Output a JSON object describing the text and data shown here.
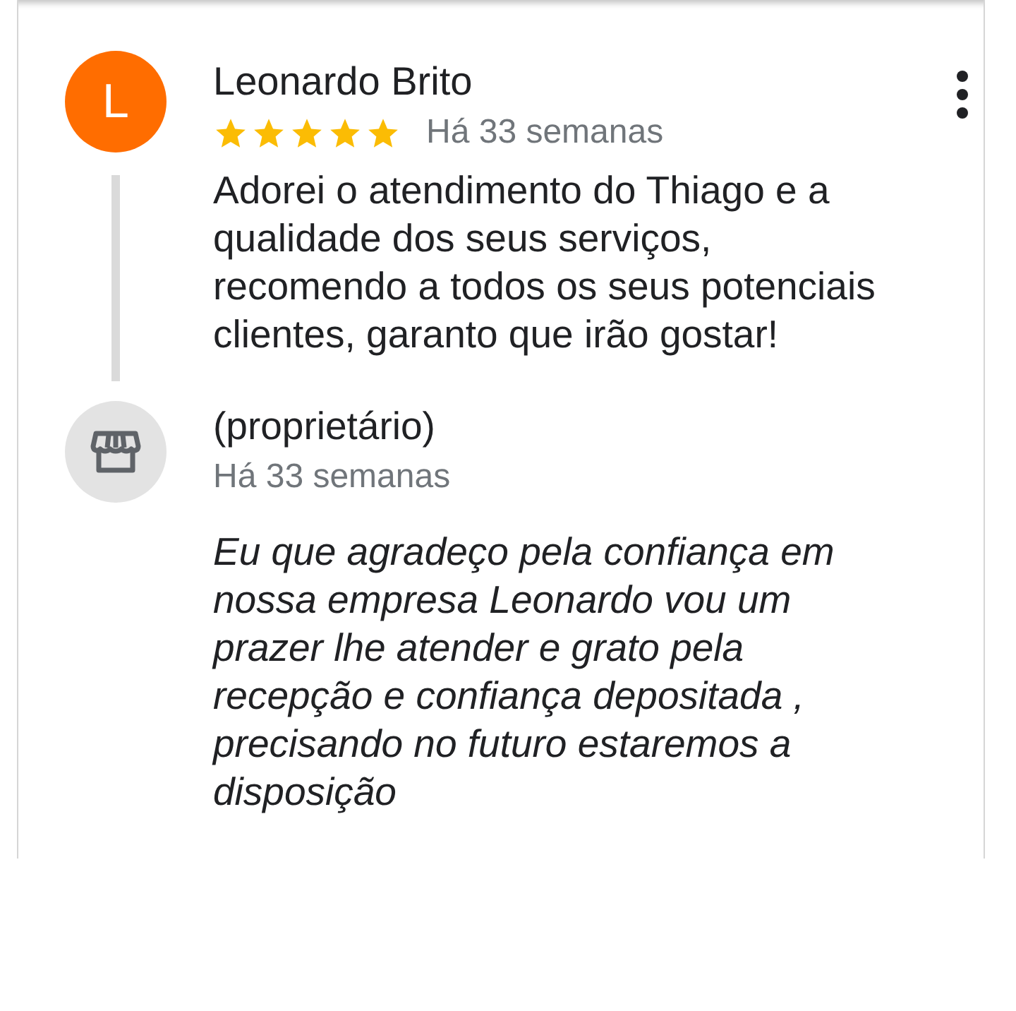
{
  "review": {
    "author_initial": "L",
    "author": "Leonardo Brito",
    "stars": 5,
    "time": "Há 33 semanas",
    "text": "Adorei o atendimento do Thiago e a qualidade dos seus serviços, recomendo a todos os seus potenciais clientes, garanto que irão gostar!"
  },
  "owner_reply": {
    "label": "(proprietário)",
    "time": "Há 33 semanas",
    "text": "Eu que agradeço pela confiança em nossa empresa Leonardo vou um prazer lhe atender e grato pela recepção e confiança depositada , precisando no futuro estaremos a disposição"
  }
}
